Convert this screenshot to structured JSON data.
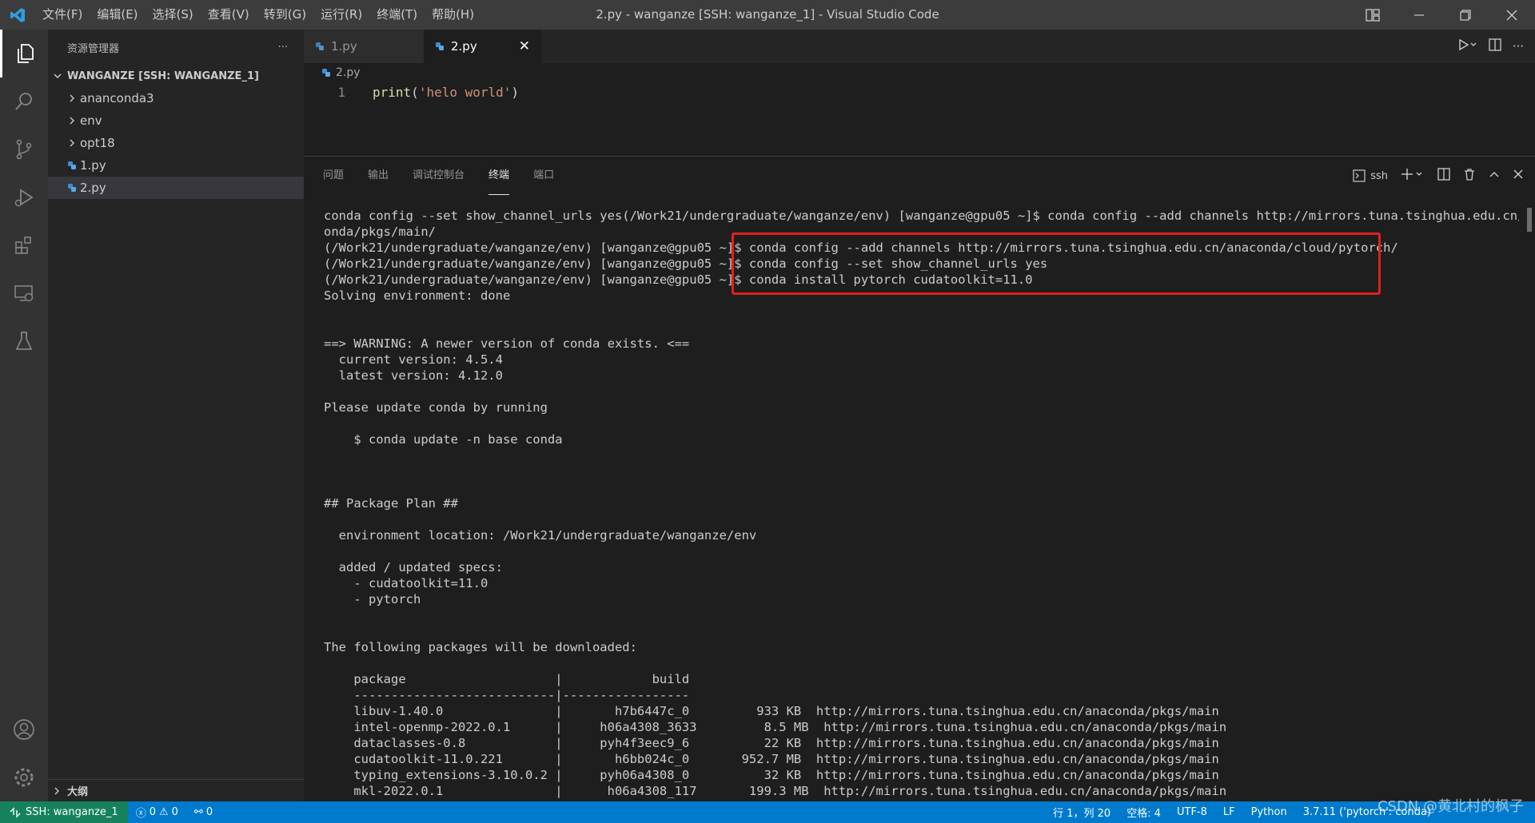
{
  "titlebar": {
    "menu": [
      "文件(F)",
      "编辑(E)",
      "选择(S)",
      "查看(V)",
      "转到(G)",
      "运行(R)",
      "终端(T)",
      "帮助(H)"
    ],
    "title": "2.py - wanganze [SSH: wanganze_1] - Visual Studio Code"
  },
  "sidebar": {
    "header": "资源管理器",
    "more": "···",
    "section": "WANGANZE [SSH: WANGANZE_1]",
    "items": [
      {
        "label": "ananconda3",
        "type": "folder"
      },
      {
        "label": "env",
        "type": "folder"
      },
      {
        "label": "opt18",
        "type": "folder"
      },
      {
        "label": "1.py",
        "type": "file"
      },
      {
        "label": "2.py",
        "type": "file"
      }
    ],
    "outline": "大纲"
  },
  "editor": {
    "tabs": [
      {
        "label": "1.py"
      },
      {
        "label": "2.py"
      }
    ],
    "close": "✕",
    "breadcrumb": "2.py",
    "lines": [
      {
        "no": "1",
        "fn": "print",
        "open": "(",
        "str": "'helo world'",
        "close": ")"
      }
    ]
  },
  "panel": {
    "tabs": [
      "问题",
      "输出",
      "调试控制台",
      "终端",
      "端口"
    ],
    "shell": "ssh",
    "terminal": [
      "conda config --set show_channel_urls yes(/Work21/undergraduate/wanganze/env) [wanganze@gpu05 ~]$ conda config --add channels http://mirrors.tuna.tsinghua.edu.cn/anac",
      "onda/pkgs/main/",
      "(/Work21/undergraduate/wanganze/env) [wanganze@gpu05 ~]$ conda config --add channels http://mirrors.tuna.tsinghua.edu.cn/anaconda/cloud/pytorch/",
      "(/Work21/undergraduate/wanganze/env) [wanganze@gpu05 ~]$ conda config --set show_channel_urls yes",
      "(/Work21/undergraduate/wanganze/env) [wanganze@gpu05 ~]$ conda install pytorch cudatoolkit=11.0",
      "Solving environment: done",
      "",
      "",
      "==> WARNING: A newer version of conda exists. <==",
      "  current version: 4.5.4",
      "  latest version: 4.12.0",
      "",
      "Please update conda by running",
      "",
      "    $ conda update -n base conda",
      "",
      "",
      "",
      "## Package Plan ##",
      "",
      "  environment location: /Work21/undergraduate/wanganze/env",
      "",
      "  added / updated specs:",
      "    - cudatoolkit=11.0",
      "    - pytorch",
      "",
      "",
      "The following packages will be downloaded:",
      "",
      "    package                    |            build",
      "    ---------------------------|-----------------",
      "    libuv-1.40.0               |       h7b6447c_0         933 KB  http://mirrors.tuna.tsinghua.edu.cn/anaconda/pkgs/main",
      "    intel-openmp-2022.0.1      |     h06a4308_3633         8.5 MB  http://mirrors.tuna.tsinghua.edu.cn/anaconda/pkgs/main",
      "    dataclasses-0.8            |     pyh4f3eec9_6          22 KB  http://mirrors.tuna.tsinghua.edu.cn/anaconda/pkgs/main",
      "    cudatoolkit-11.0.221       |       h6bb024c_0       952.7 MB  http://mirrors.tuna.tsinghua.edu.cn/anaconda/pkgs/main",
      "    typing_extensions-3.10.0.2 |     pyh06a4308_0          32 KB  http://mirrors.tuna.tsinghua.edu.cn/anaconda/pkgs/main",
      "    mkl-2022.0.1               |      h06a4308_117       199.3 MB  http://mirrors.tuna.tsinghua.edu.cn/anaconda/pkgs/main"
    ]
  },
  "statusbar": {
    "remote": "SSH: wanganze_1",
    "errors": "0",
    "warnings": "0",
    "ports": "0",
    "position": "行 1，列 20",
    "spaces": "空格: 4",
    "encoding": "UTF-8",
    "eol": "LF",
    "language": "Python",
    "interpreter": "3.7.11 ('pytorch': conda)"
  },
  "watermark": "CSDN @黄北村的枫子",
  "colors": {
    "accent": "#007acc",
    "remote": "#16825d",
    "highlight": "#e02020"
  }
}
